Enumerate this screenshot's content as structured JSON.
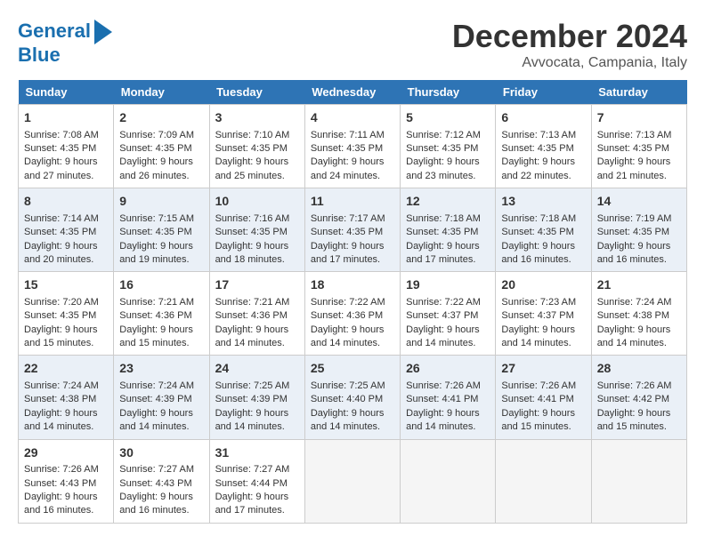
{
  "logo": {
    "line1": "General",
    "line2": "Blue"
  },
  "title": "December 2024",
  "location": "Avvocata, Campania, Italy",
  "days": [
    "Sunday",
    "Monday",
    "Tuesday",
    "Wednesday",
    "Thursday",
    "Friday",
    "Saturday"
  ],
  "weeks": [
    [
      {
        "num": "1",
        "rise": "7:08 AM",
        "set": "4:35 PM",
        "daylight": "9 hours and 27 minutes."
      },
      {
        "num": "2",
        "rise": "7:09 AM",
        "set": "4:35 PM",
        "daylight": "9 hours and 26 minutes."
      },
      {
        "num": "3",
        "rise": "7:10 AM",
        "set": "4:35 PM",
        "daylight": "9 hours and 25 minutes."
      },
      {
        "num": "4",
        "rise": "7:11 AM",
        "set": "4:35 PM",
        "daylight": "9 hours and 24 minutes."
      },
      {
        "num": "5",
        "rise": "7:12 AM",
        "set": "4:35 PM",
        "daylight": "9 hours and 23 minutes."
      },
      {
        "num": "6",
        "rise": "7:13 AM",
        "set": "4:35 PM",
        "daylight": "9 hours and 22 minutes."
      },
      {
        "num": "7",
        "rise": "7:13 AM",
        "set": "4:35 PM",
        "daylight": "9 hours and 21 minutes."
      }
    ],
    [
      {
        "num": "8",
        "rise": "7:14 AM",
        "set": "4:35 PM",
        "daylight": "9 hours and 20 minutes."
      },
      {
        "num": "9",
        "rise": "7:15 AM",
        "set": "4:35 PM",
        "daylight": "9 hours and 19 minutes."
      },
      {
        "num": "10",
        "rise": "7:16 AM",
        "set": "4:35 PM",
        "daylight": "9 hours and 18 minutes."
      },
      {
        "num": "11",
        "rise": "7:17 AM",
        "set": "4:35 PM",
        "daylight": "9 hours and 17 minutes."
      },
      {
        "num": "12",
        "rise": "7:18 AM",
        "set": "4:35 PM",
        "daylight": "9 hours and 17 minutes."
      },
      {
        "num": "13",
        "rise": "7:18 AM",
        "set": "4:35 PM",
        "daylight": "9 hours and 16 minutes."
      },
      {
        "num": "14",
        "rise": "7:19 AM",
        "set": "4:35 PM",
        "daylight": "9 hours and 16 minutes."
      }
    ],
    [
      {
        "num": "15",
        "rise": "7:20 AM",
        "set": "4:35 PM",
        "daylight": "9 hours and 15 minutes."
      },
      {
        "num": "16",
        "rise": "7:21 AM",
        "set": "4:36 PM",
        "daylight": "9 hours and 15 minutes."
      },
      {
        "num": "17",
        "rise": "7:21 AM",
        "set": "4:36 PM",
        "daylight": "9 hours and 14 minutes."
      },
      {
        "num": "18",
        "rise": "7:22 AM",
        "set": "4:36 PM",
        "daylight": "9 hours and 14 minutes."
      },
      {
        "num": "19",
        "rise": "7:22 AM",
        "set": "4:37 PM",
        "daylight": "9 hours and 14 minutes."
      },
      {
        "num": "20",
        "rise": "7:23 AM",
        "set": "4:37 PM",
        "daylight": "9 hours and 14 minutes."
      },
      {
        "num": "21",
        "rise": "7:24 AM",
        "set": "4:38 PM",
        "daylight": "9 hours and 14 minutes."
      }
    ],
    [
      {
        "num": "22",
        "rise": "7:24 AM",
        "set": "4:38 PM",
        "daylight": "9 hours and 14 minutes."
      },
      {
        "num": "23",
        "rise": "7:24 AM",
        "set": "4:39 PM",
        "daylight": "9 hours and 14 minutes."
      },
      {
        "num": "24",
        "rise": "7:25 AM",
        "set": "4:39 PM",
        "daylight": "9 hours and 14 minutes."
      },
      {
        "num": "25",
        "rise": "7:25 AM",
        "set": "4:40 PM",
        "daylight": "9 hours and 14 minutes."
      },
      {
        "num": "26",
        "rise": "7:26 AM",
        "set": "4:41 PM",
        "daylight": "9 hours and 14 minutes."
      },
      {
        "num": "27",
        "rise": "7:26 AM",
        "set": "4:41 PM",
        "daylight": "9 hours and 15 minutes."
      },
      {
        "num": "28",
        "rise": "7:26 AM",
        "set": "4:42 PM",
        "daylight": "9 hours and 15 minutes."
      }
    ],
    [
      {
        "num": "29",
        "rise": "7:26 AM",
        "set": "4:43 PM",
        "daylight": "9 hours and 16 minutes."
      },
      {
        "num": "30",
        "rise": "7:27 AM",
        "set": "4:43 PM",
        "daylight": "9 hours and 16 minutes."
      },
      {
        "num": "31",
        "rise": "7:27 AM",
        "set": "4:44 PM",
        "daylight": "9 hours and 17 minutes."
      },
      null,
      null,
      null,
      null
    ]
  ]
}
